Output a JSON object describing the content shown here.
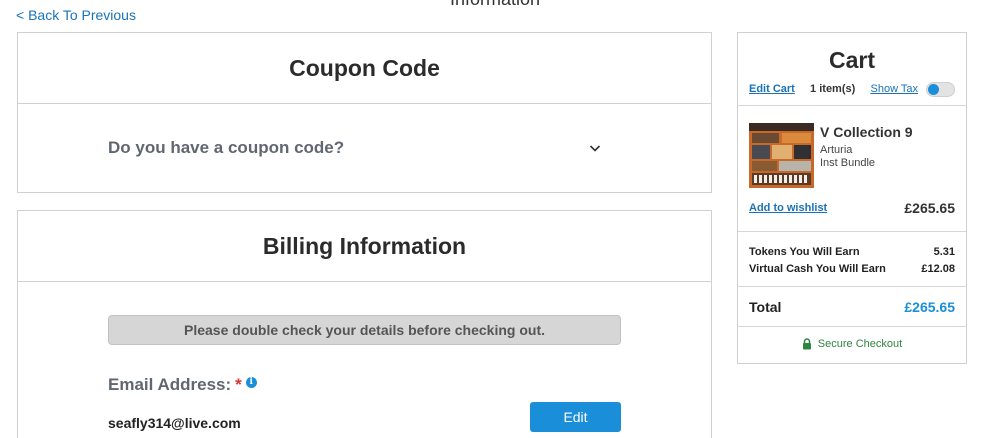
{
  "nav": {
    "back_label": "< Back To Previous",
    "top_cut_text": "Information"
  },
  "coupon": {
    "title": "Coupon Code",
    "question": "Do you have a coupon code?",
    "toggle_icon": "chevron-down-icon"
  },
  "billing": {
    "title": "Billing Information",
    "notice": "Please double check your details before checking out.",
    "email_label": "Email Address:",
    "required_marker": "*",
    "info_icon": "info-icon",
    "email_value": "seafly314@live.com",
    "edit_label": "Edit"
  },
  "cart": {
    "title": "Cart",
    "edit_cart_label": "Edit Cart",
    "items_count": "1 item(s)",
    "show_tax_label": "Show Tax",
    "show_tax_enabled": false,
    "product": {
      "name": "V Collection 9",
      "brand": "Arturia",
      "type": "Inst Bundle",
      "wishlist_label": "Add to wishlist",
      "price": "£265.65"
    },
    "summary": [
      {
        "label": "Tokens You Will Earn",
        "value": "5.31"
      },
      {
        "label": "Virtual Cash You Will Earn",
        "value": "£12.08"
      }
    ],
    "total_label": "Total",
    "total_value": "£265.65",
    "secure_label": "Secure Checkout"
  },
  "colors": {
    "accent": "#1a8ed8",
    "link": "#1a73b8",
    "secure": "#2e8540",
    "required": "#dd3333"
  }
}
